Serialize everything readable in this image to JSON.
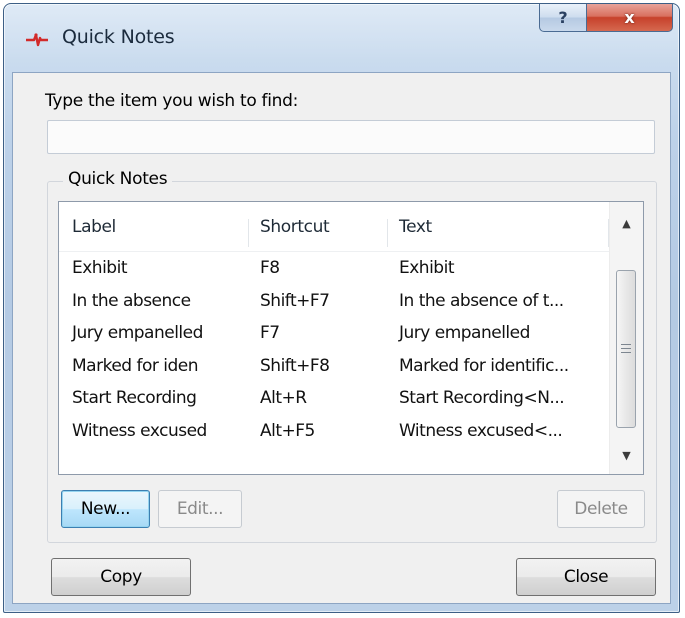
{
  "window": {
    "title": "Quick Notes",
    "help_label": "?",
    "close_label": "x"
  },
  "find": {
    "label": "Type the item you wish to find:",
    "value": ""
  },
  "group": {
    "legend": "Quick Notes"
  },
  "list": {
    "columns": [
      "Label",
      "Shortcut",
      "Text"
    ],
    "rows": [
      [
        "Exhibit",
        "F8",
        "Exhibit"
      ],
      [
        "In the absence",
        "Shift+F7",
        "In the absence of t..."
      ],
      [
        "Jury empanelled",
        "F7",
        "Jury empanelled"
      ],
      [
        "Marked for iden",
        "Shift+F8",
        "Marked for identific..."
      ],
      [
        "Start Recording",
        "Alt+R",
        "Start Recording<N..."
      ],
      [
        "Witness excused",
        "Alt+F5",
        "Witness excused<..."
      ]
    ]
  },
  "buttons": {
    "new": "New...",
    "edit": "Edit...",
    "delete": "Delete",
    "copy": "Copy",
    "close": "Close"
  },
  "colors": {
    "accent_default_button": "#3c7fb1",
    "close_button_red": "#c7412b",
    "app_icon_red": "#d22a2a"
  },
  "icons": {
    "app": "quick-notes-app-icon",
    "scroll_up": "scroll-up-arrow-icon",
    "scroll_down": "scroll-down-arrow-icon"
  }
}
